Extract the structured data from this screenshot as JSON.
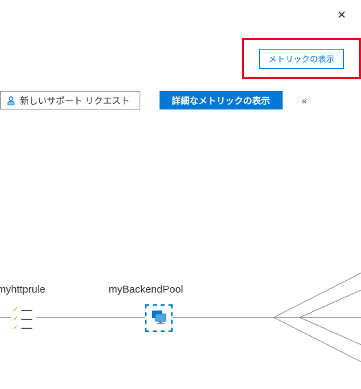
{
  "close_label": "✕",
  "highlight": {
    "metrics_button": "メトリックの表示"
  },
  "toolbar": {
    "support_button": "新しいサポート リクエスト",
    "detailed_metrics_button": "詳細なメトリックの表示",
    "collapse_glyph": "«"
  },
  "diagram": {
    "rule_label": "myhttprule",
    "pool_label": "myBackendPool"
  }
}
